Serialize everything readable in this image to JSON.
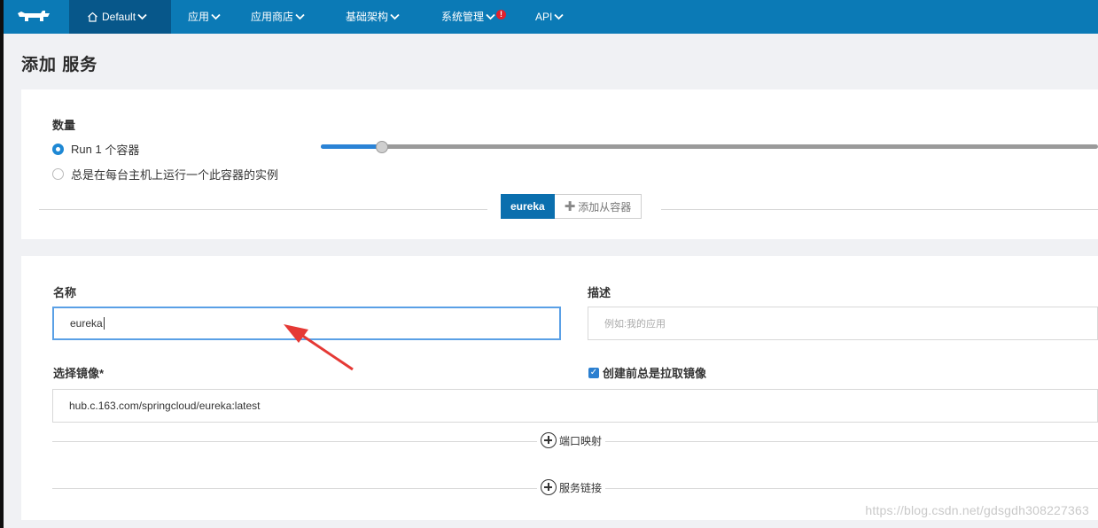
{
  "nav": {
    "env": "Default",
    "items": [
      "应用",
      "应用商店",
      "基础架构",
      "系统管理",
      "API"
    ],
    "alert_mark": "!"
  },
  "page": {
    "title": "添加 服务"
  },
  "scale": {
    "label": "数量",
    "option_run_prefix": "Run",
    "count": 1,
    "option_run_suffix": "个容器",
    "option_global": "总是在每台主机上运行一个此容器的实例"
  },
  "containers": {
    "active_tab": "eureka",
    "add_sidekick": "添加从容器"
  },
  "form": {
    "name_label": "名称",
    "name_value": "eureka",
    "desc_label": "描述",
    "desc_placeholder": "例如:我的应用",
    "image_label": "选择镜像*",
    "image_value": "hub.c.163.com/springcloud/eureka:latest",
    "pull_checkbox_label": "创建前总是拉取镜像",
    "port_map": "端口映射",
    "service_link": "服务链接"
  },
  "watermark": "https://blog.csdn.net/gdsgdh308227363",
  "colors": {
    "nav_bg": "#0b7ab6",
    "accent": "#2a83d6",
    "arrow": "#e53935"
  }
}
